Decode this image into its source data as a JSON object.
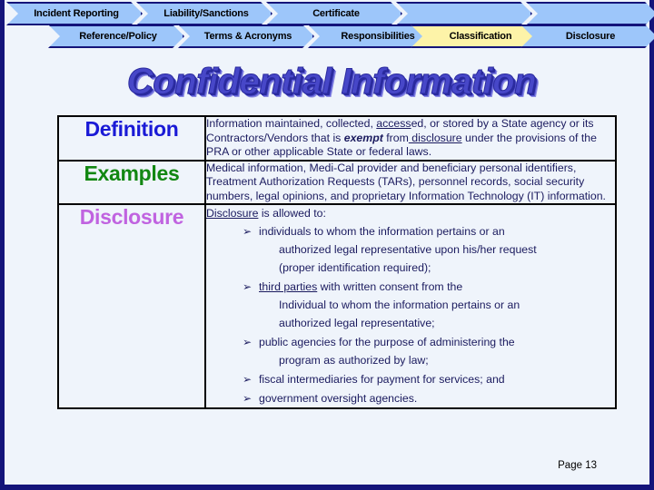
{
  "slide": {
    "title": "Confidential Information",
    "page_label": "Page 13"
  },
  "nav": {
    "row1": [
      {
        "label": "Incident Reporting",
        "active": false
      },
      {
        "label": "Liability/Sanctions",
        "active": false
      },
      {
        "label": "Certificate",
        "active": false
      },
      {
        "label": "",
        "active": false
      },
      {
        "label": "",
        "active": false
      }
    ],
    "row2": [
      {
        "label": "Reference/Policy",
        "active": false
      },
      {
        "label": "Terms & Acronyms",
        "active": false
      },
      {
        "label": "Responsibilities",
        "active": false
      },
      {
        "label": "Classification",
        "active": true
      },
      {
        "label": "Disclosure",
        "active": false
      }
    ]
  },
  "table": {
    "rows": [
      {
        "label": "Definition",
        "label_color": "#1a1ad6",
        "text_parts": [
          {
            "t": "Information maintained, collected, ",
            "style": "plain"
          },
          {
            "t": "access",
            "style": "underline"
          },
          {
            "t": "ed, or stored by a State agency or its Contractors/Vendors that is ",
            "style": "plain"
          },
          {
            "t": "exempt",
            "style": "bold-italic"
          },
          {
            "t": " from",
            "style": "plain"
          },
          {
            "t": " disclosure",
            "style": "underline"
          },
          {
            "t": " under the provisions of the PRA or other applicable State or federal laws.",
            "style": "plain"
          }
        ]
      },
      {
        "label": "Examples",
        "label_color": "#128712",
        "text_parts": [
          {
            "t": "Medical information, Medi-Cal provider and beneficiary personal identifiers, Treatment Authorization Requests (TARs), personnel records, social security numbers, legal opinions, and proprietary Information Technology (IT) information.",
            "style": "plain"
          }
        ]
      }
    ],
    "disclosure": {
      "label": "Disclosure",
      "label_color": "#c063e0",
      "intro_underlined": "Disclosure",
      "intro_rest": " is allowed to:",
      "bullet_glyph": "➢",
      "bullets": [
        {
          "main": "individuals to whom the information pertains or an",
          "continuations": [
            "authorized legal representative upon his/her request",
            "(proper identification required);"
          ]
        },
        {
          "underlined_lead": "third parties",
          "main": " with written consent from the",
          "continuations": [
            "Individual to whom the information pertains or an",
            "authorized legal representative;"
          ]
        },
        {
          "main": "public agencies for the purpose of administering the",
          "continuations": [
            "program as authorized by law;"
          ]
        },
        {
          "main": "fiscal intermediaries for payment for services; and",
          "continuations": []
        },
        {
          "main": "government oversight agencies.",
          "continuations": []
        }
      ]
    }
  },
  "colors": {
    "tab_fill": "#9dc6fa",
    "tab_active_fill": "#fdf3a8",
    "tab_border": "#14147a",
    "slide_bg": "#eff4fb",
    "slide_border": "#14147a",
    "body_text": "#1a1a5e",
    "title_text": "#4747c8"
  }
}
